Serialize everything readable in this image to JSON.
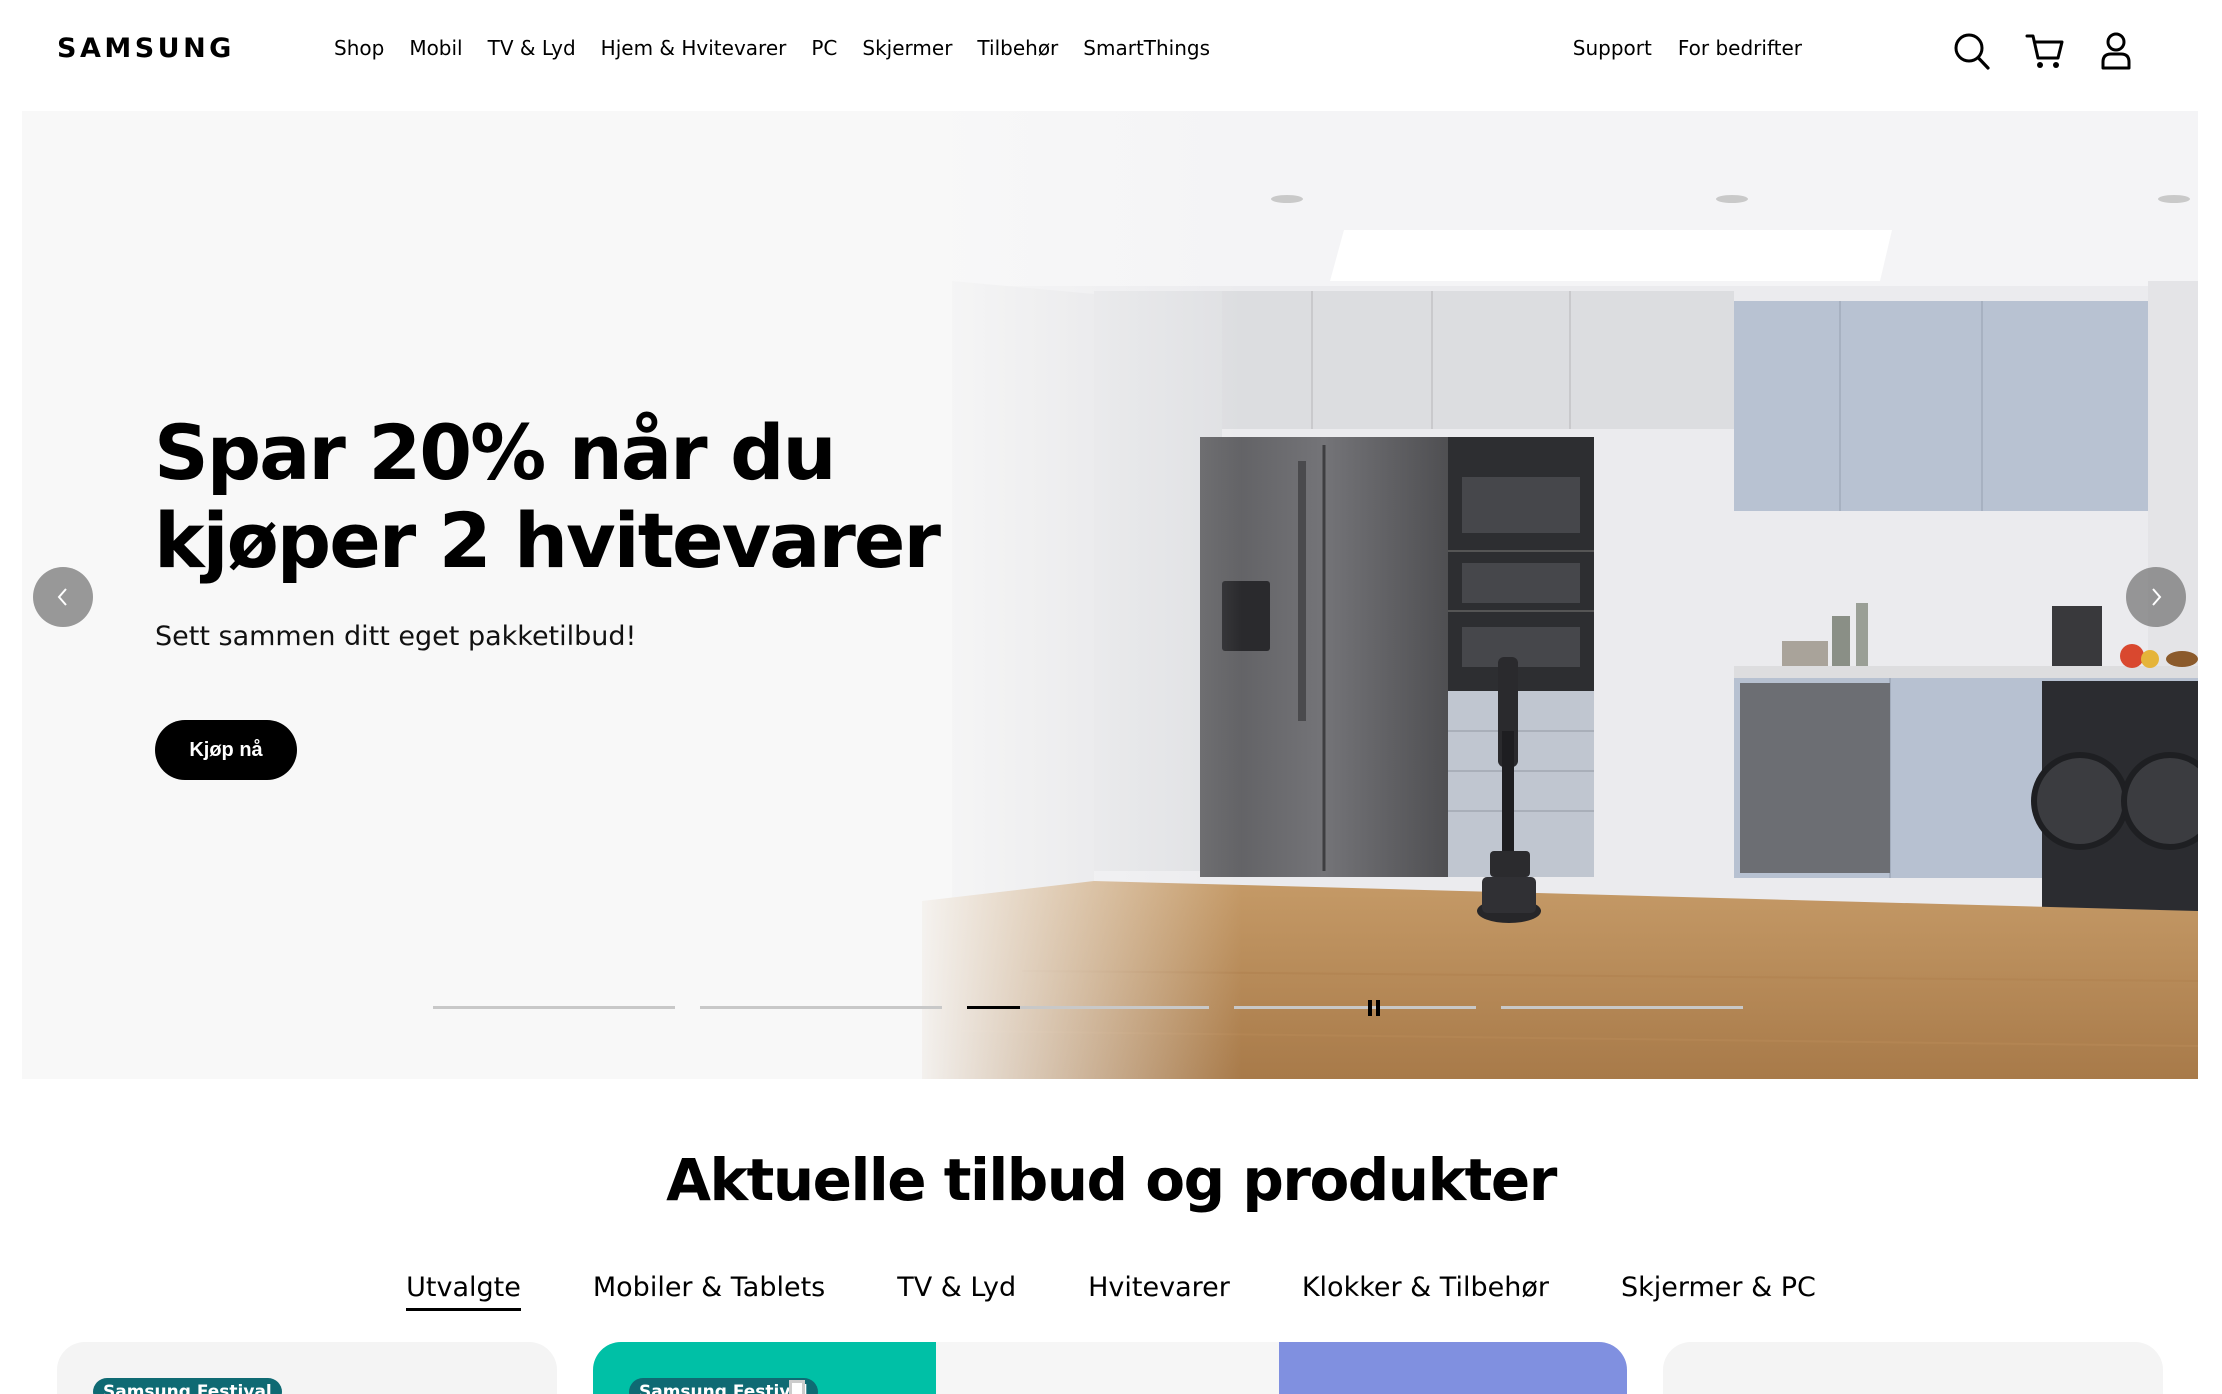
{
  "header": {
    "logo": "SAMSUNG",
    "nav": [
      "Shop",
      "Mobil",
      "TV & Lyd",
      "Hjem & Hvitevarer",
      "PC",
      "Skjermer",
      "Tilbehør",
      "SmartThings"
    ],
    "utility": [
      "Support",
      "For bedrifter"
    ],
    "icons": [
      "search-icon",
      "cart-icon",
      "user-icon"
    ]
  },
  "hero": {
    "title": "Spar 20% når du kjøper 2 hvitevarer",
    "subtitle": "Sett sammen ditt eget pakketilbud!",
    "cta": "Kjøp nå",
    "slides_total": 5,
    "active_slide": 3,
    "active_progress": 0.22
  },
  "section": {
    "title": "Aktuelle tilbud og produkter",
    "tabs": [
      "Utvalgte",
      "Mobiler & Tablets",
      "TV & Lyd",
      "Hvitevarer",
      "Klokker & Tilbehør",
      "Skjermer & PC"
    ],
    "active_tab": "Utvalgte"
  },
  "cards": [
    {
      "badge": "Samsung Festival"
    },
    {
      "badge": "Samsung Festival"
    },
    {
      "badge": ""
    },
    {
      "badge": ""
    }
  ],
  "colors": {
    "badge": "#0f6a73",
    "teal_card": "#00c0a6",
    "purple_card": "#8090e0",
    "cta": "#000000"
  }
}
